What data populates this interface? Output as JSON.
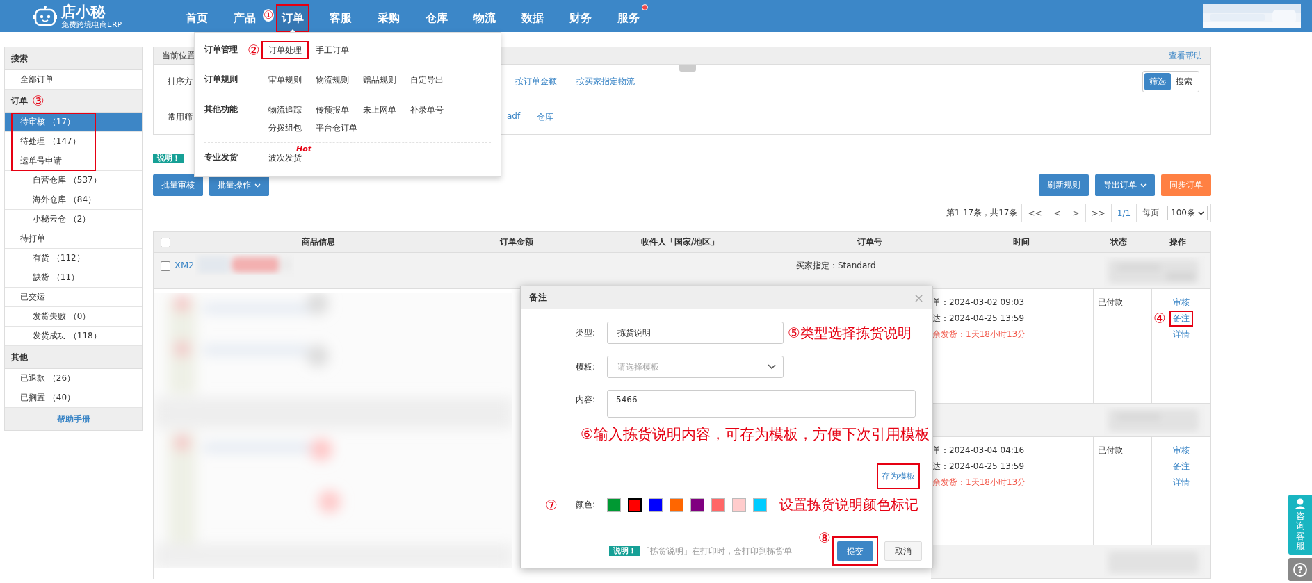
{
  "nav": {
    "logo": {
      "name": "店小秘",
      "tagline": "免费跨境电商ERP"
    },
    "items": [
      {
        "label": "首页",
        "selected": false,
        "highlighted": false,
        "dot": false
      },
      {
        "label": "产品",
        "selected": false,
        "highlighted": false,
        "dot": false
      },
      {
        "label": "订单",
        "selected": true,
        "highlighted": true,
        "dot": false,
        "marker": "①"
      },
      {
        "label": "客服",
        "selected": false,
        "highlighted": false,
        "dot": false
      },
      {
        "label": "采购",
        "selected": false,
        "highlighted": false,
        "dot": false
      },
      {
        "label": "仓库",
        "selected": false,
        "highlighted": false,
        "dot": false
      },
      {
        "label": "物流",
        "selected": false,
        "highlighted": false,
        "dot": false
      },
      {
        "label": "数据",
        "selected": false,
        "highlighted": false,
        "dot": false
      },
      {
        "label": "财务",
        "selected": false,
        "highlighted": false,
        "dot": false
      },
      {
        "label": "服务",
        "selected": false,
        "highlighted": false,
        "dot": true
      }
    ]
  },
  "menu": {
    "groups": [
      {
        "title": "订单管理",
        "items": [
          {
            "label": "订单处理",
            "highlighted": true,
            "marker": "②"
          },
          {
            "label": "手工订单",
            "highlighted": false
          }
        ]
      },
      {
        "title": "订单规则",
        "items": [
          {
            "label": "审单规则",
            "highlighted": false
          },
          {
            "label": "物流规则",
            "highlighted": false
          },
          {
            "label": "赠品规则",
            "highlighted": false
          },
          {
            "label": "自定导出",
            "highlighted": false
          }
        ]
      },
      {
        "title": "其他功能",
        "items": [
          {
            "label": "物流追踪",
            "highlighted": false
          },
          {
            "label": "传预报单",
            "highlighted": false
          },
          {
            "label": "未上网单",
            "highlighted": false
          },
          {
            "label": "补录单号",
            "highlighted": false
          },
          {
            "label": "分拨组包",
            "highlighted": false
          },
          {
            "label": "平台仓订单",
            "highlighted": false
          }
        ]
      },
      {
        "title": "专业发货",
        "items": [
          {
            "label": "波次发货",
            "highlighted": false,
            "tag": "Hot"
          }
        ]
      }
    ]
  },
  "sidebar": {
    "sections": [
      {
        "title": "搜索",
        "items": [
          {
            "label": "全部订单",
            "selected": false,
            "highlighted": false
          }
        ]
      },
      {
        "title": "订单",
        "marker": "③",
        "items": [
          {
            "label": "待审核 （17）",
            "selected": true,
            "highlighted": true
          },
          {
            "label": "待处理 （147）",
            "selected": false,
            "highlighted": true
          },
          {
            "label": "运单号申请",
            "selected": false,
            "highlighted": true,
            "children": [
              {
                "label": "自营仓库 （537）",
                "selected": false,
                "highlighted": false
              },
              {
                "label": "海外仓库 （84）",
                "selected": false,
                "highlighted": false
              },
              {
                "label": "小秘云仓 （2）",
                "selected": false,
                "highlighted": false
              }
            ]
          },
          {
            "label": "待打单",
            "selected": false,
            "highlighted": false,
            "children": [
              {
                "label": "有货 （112）",
                "selected": false,
                "highlighted": false
              },
              {
                "label": "缺货 （11）",
                "selected": false,
                "highlighted": false
              }
            ]
          },
          {
            "label": "已交运",
            "selected": false,
            "highlighted": false,
            "children": [
              {
                "label": "发货失败 （0）",
                "selected": false,
                "highlighted": false
              },
              {
                "label": "发货成功 （118）",
                "selected": false,
                "highlighted": false
              }
            ]
          }
        ]
      },
      {
        "title": "其他",
        "items": [
          {
            "label": "已退款 （26）",
            "selected": false,
            "highlighted": false
          },
          {
            "label": "已搁置 （40）",
            "selected": false,
            "highlighted": false
          }
        ]
      }
    ],
    "footer": "帮助手册"
  },
  "breadcrumb": {
    "label": "当前位置",
    "help": "查看帮助"
  },
  "filters": {
    "rows": [
      {
        "label": "排序方",
        "options": [
          "按订单金额",
          "按买家指定物流"
        ]
      },
      {
        "label": "常用筛",
        "options": [
          "adf",
          "仓库"
        ]
      }
    ],
    "modes": [
      {
        "label": "筛选",
        "selected": true
      },
      {
        "label": "搜索",
        "selected": false
      }
    ]
  },
  "notice": {
    "badge": "说明！"
  },
  "actions": {
    "left": [
      {
        "label": "批量审核",
        "dropdown": false
      },
      {
        "label": "批量操作",
        "dropdown": true
      }
    ],
    "right": [
      {
        "label": "刷新规则",
        "kind": "primary",
        "dropdown": false
      },
      {
        "label": "导出订单",
        "kind": "primary",
        "dropdown": true
      },
      {
        "label": "同步订单",
        "kind": "warning",
        "dropdown": false
      }
    ]
  },
  "pagination": {
    "summary": "第1-17条，共17条",
    "buttons": [
      "<<",
      "<",
      ">",
      ">>"
    ],
    "page": "1/1",
    "per_page_label": "每页",
    "per_page": "100条"
  },
  "table": {
    "select_all": {
      "checked": false
    },
    "columns": [
      "商品信息",
      "订单金额",
      "收件人「国家/地区」",
      "订单号",
      "时间",
      "状态",
      "操作"
    ],
    "orders": [
      {
        "id": "XM2",
        "checked": false,
        "buyer_shipping": "买家指定：Standard",
        "times": [
          {
            "text": "单：2024-03-02 09:03",
            "kind": "normal"
          },
          {
            "text": "达：2024-04-25 13:59",
            "kind": "normal"
          },
          {
            "text": "余发货：1天18小时13分",
            "kind": "warning"
          }
        ],
        "status": "已付款",
        "ops": [
          {
            "label": "审核",
            "highlighted": false
          },
          {
            "label": "备注",
            "highlighted": true,
            "marker": "④"
          },
          {
            "label": "详情",
            "highlighted": false
          }
        ]
      },
      {
        "times": [
          {
            "text": "单：2024-03-04 04:16",
            "kind": "normal"
          },
          {
            "text": "达：2024-04-25 13:59",
            "kind": "normal"
          },
          {
            "text": "余发货：1天18小时13分",
            "kind": "warning"
          }
        ],
        "status": "已付款",
        "ops": [
          {
            "label": "审核",
            "highlighted": false
          },
          {
            "label": "备注",
            "highlighted": false
          },
          {
            "label": "详情",
            "highlighted": false
          }
        ]
      }
    ]
  },
  "modal": {
    "title": "备注",
    "close": "×",
    "fields": [
      {
        "label": "类型:",
        "kind": "select",
        "value": "拣货说明",
        "note": "⑤类型选择拣货说明"
      },
      {
        "label": "模板:",
        "kind": "select",
        "placeholder": "请选择模板"
      },
      {
        "label": "内容:",
        "kind": "textarea",
        "value": "5466",
        "note": "⑥输入拣货说明内容，可存为模板，方便下次引用模板"
      }
    ],
    "save_template": {
      "label": "存为模板",
      "highlighted": true
    },
    "color_label": "颜色:",
    "color_marker": "⑦",
    "color_note": "设置拣货说明颜色标记",
    "colors": [
      {
        "color": "#009933",
        "selected": false
      },
      {
        "color": "#ff0000",
        "selected": true
      },
      {
        "color": "#0000ff",
        "selected": false
      },
      {
        "color": "#ff6600",
        "selected": false
      },
      {
        "color": "#800080",
        "selected": false
      },
      {
        "color": "#ff6666",
        "selected": false
      },
      {
        "color": "#ffcccc",
        "selected": false
      },
      {
        "color": "#00ccff",
        "selected": false
      }
    ],
    "notice": {
      "badge": "说明！",
      "text": "「拣货说明」在打印时，会打印到拣货单"
    },
    "buttons": [
      {
        "label": "提交",
        "kind": "primary",
        "highlighted": true,
        "marker": "⑧"
      },
      {
        "label": "取消",
        "kind": "default",
        "highlighted": false
      }
    ]
  },
  "support": {
    "label": "咨询客服",
    "help": "?"
  }
}
